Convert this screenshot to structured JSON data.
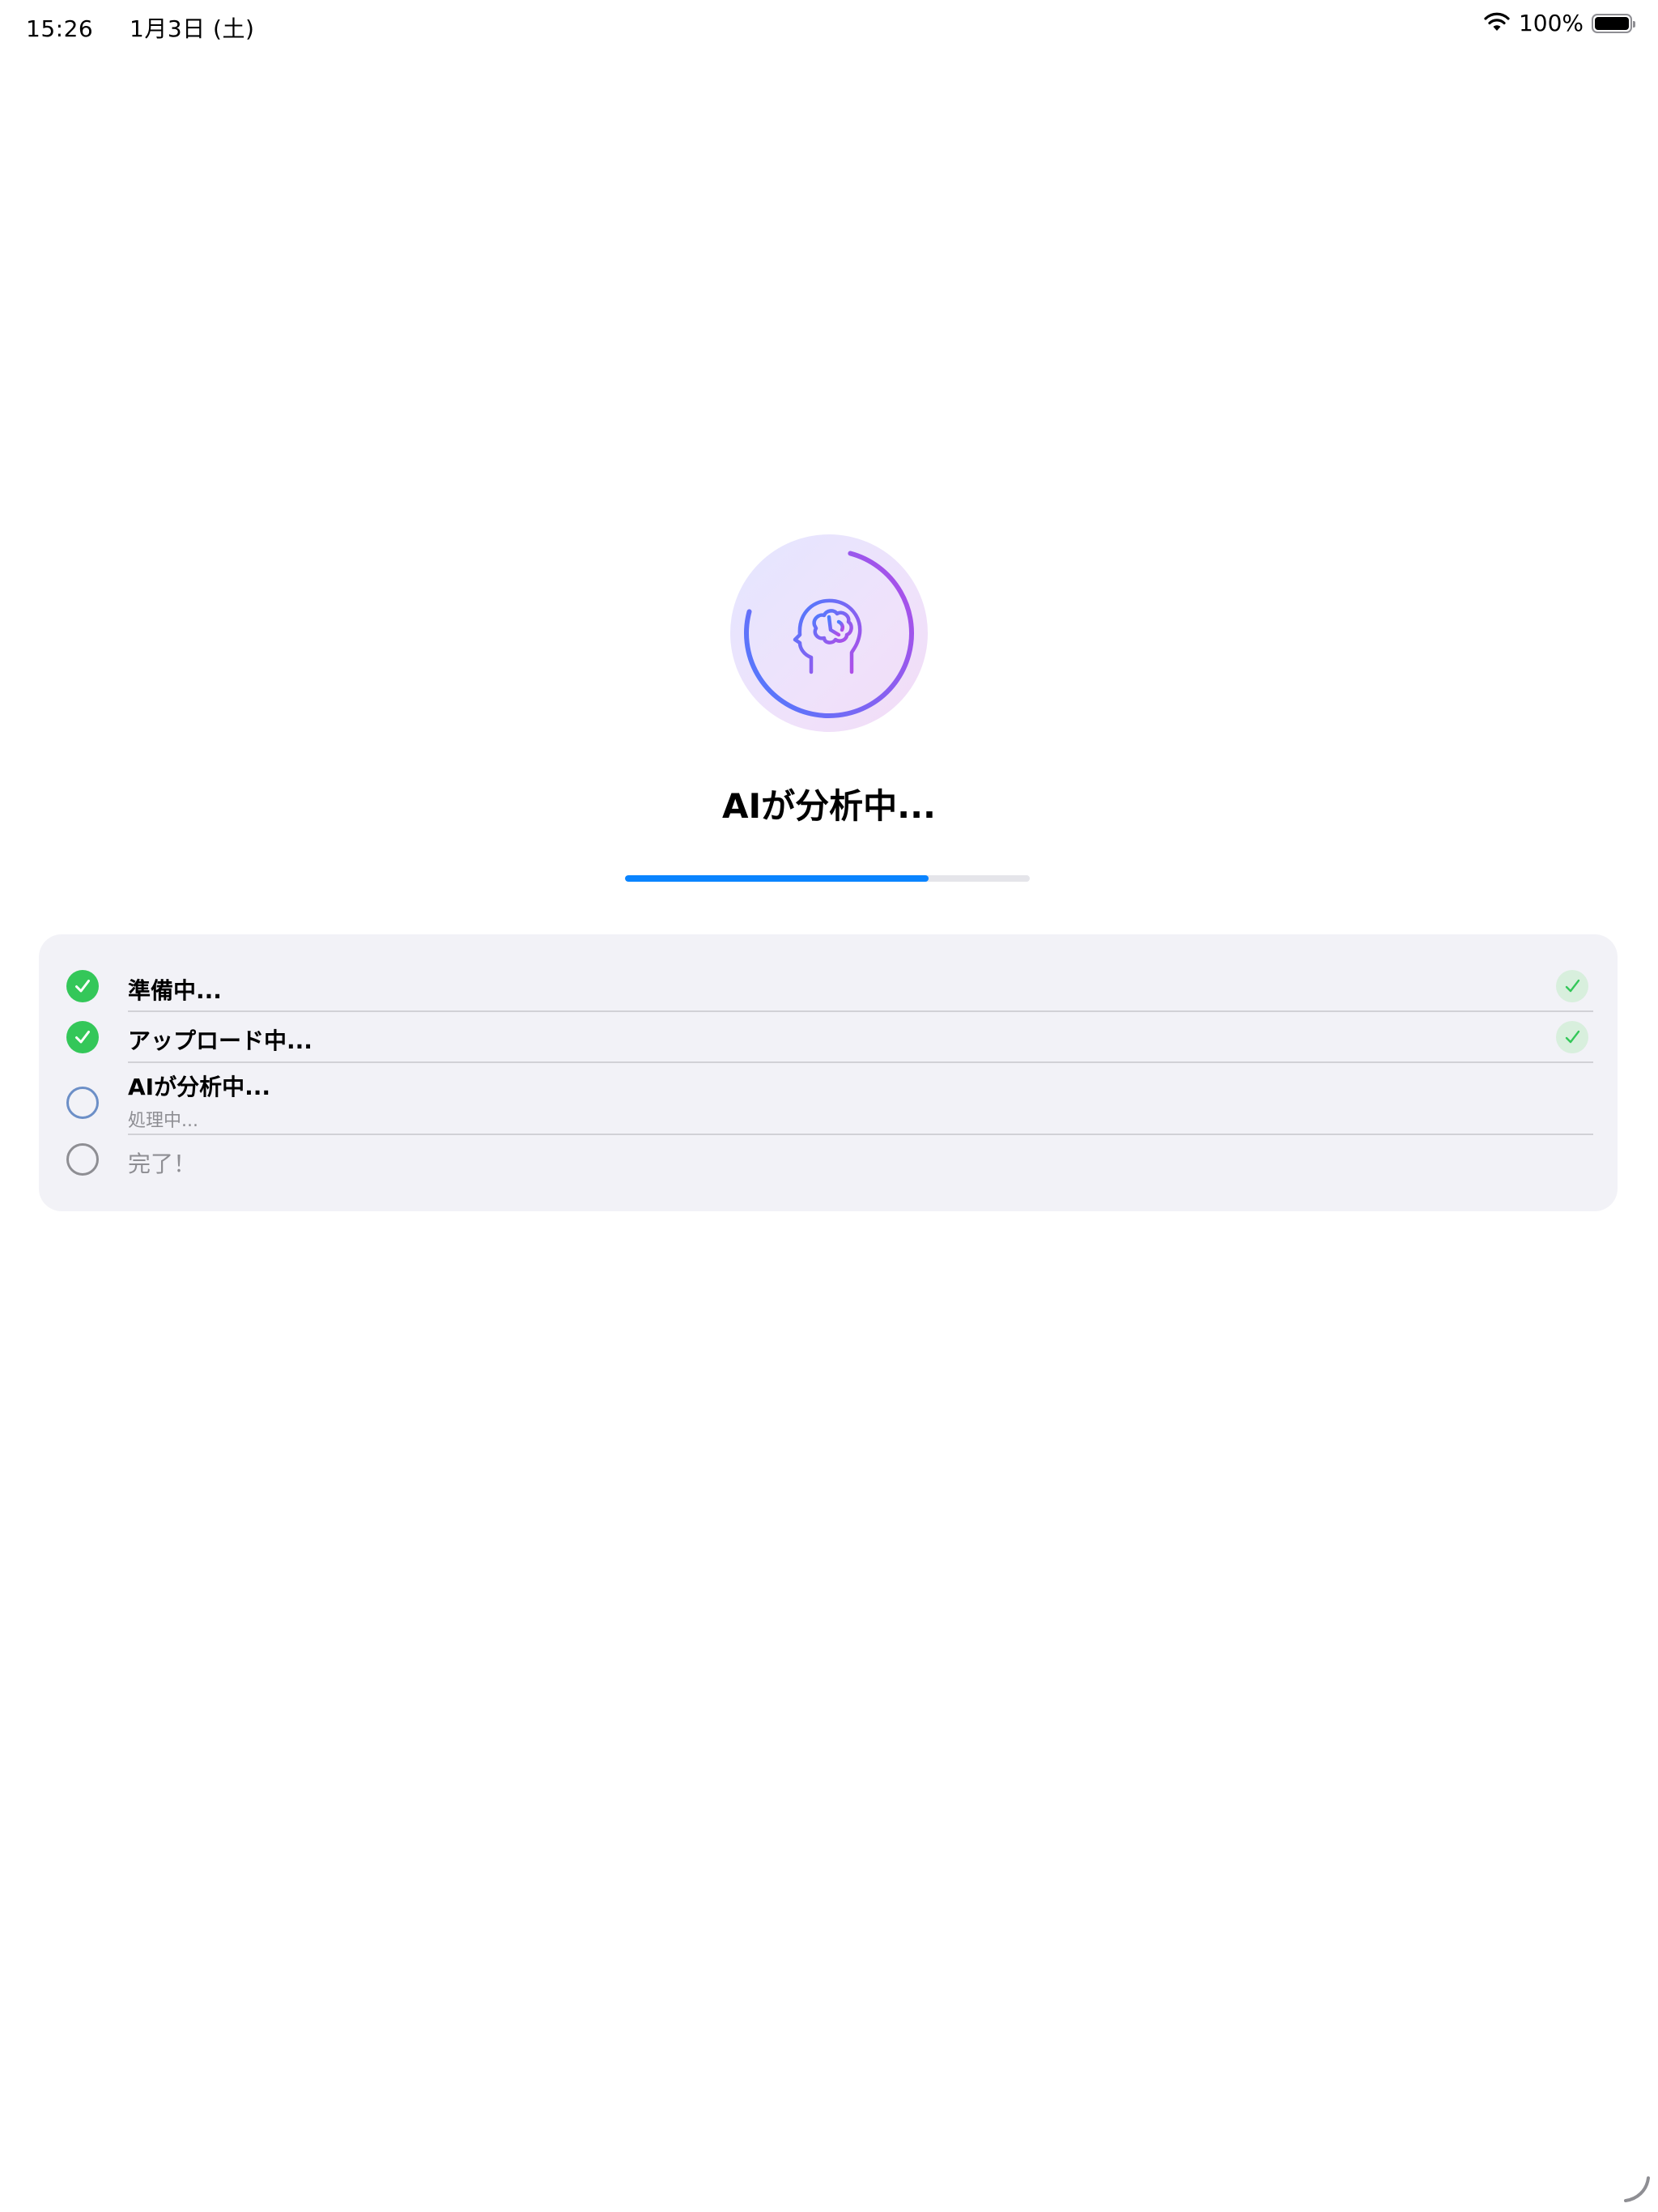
{
  "status_bar": {
    "time": "15:26",
    "date": "1月3日 (土)",
    "battery_percent": "100%",
    "battery_level": 1.0,
    "icons": [
      "wifi-icon",
      "battery-icon"
    ]
  },
  "hero": {
    "icon": "brain-head-icon",
    "ring_progress": 0.75,
    "gradient_colors": [
      "#4a7dff",
      "#b44be6"
    ]
  },
  "title": "AIが分析中...",
  "progress": {
    "value": 0.75,
    "color": "#0a84ff"
  },
  "steps": [
    {
      "label": "準備中...",
      "status": "done"
    },
    {
      "label": "アップロード中...",
      "status": "done"
    },
    {
      "label": "AIが分析中...",
      "subtitle": "処理中...",
      "status": "active"
    },
    {
      "label": "完了！",
      "status": "pending"
    }
  ],
  "colors": {
    "done": "#34c759",
    "active": "#6c8fc7",
    "pending": "#8e8e93"
  }
}
